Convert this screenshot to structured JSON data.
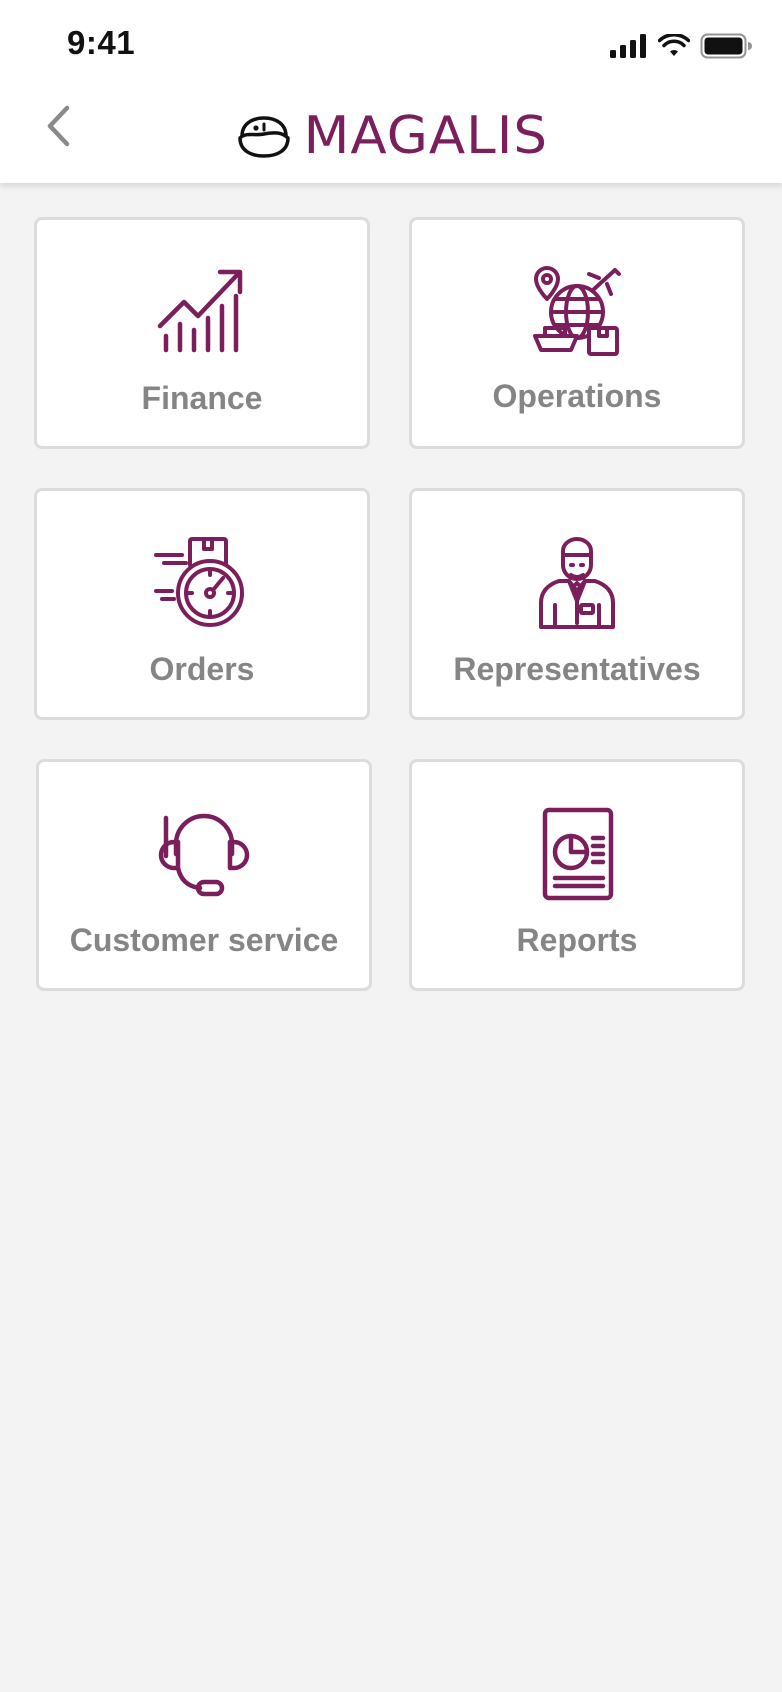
{
  "status_bar": {
    "time": "9:41",
    "icons": [
      "cellular-signal-icon",
      "wifi-icon",
      "battery-icon"
    ]
  },
  "header": {
    "back_icon": "chevron-left-icon",
    "logo_icon": "magalis-mascot-icon",
    "logo_text": "MAGALIS"
  },
  "theme": {
    "brand_color": "#7a1f5c",
    "label_color": "#858585",
    "tile_border": "#dcdcdc",
    "background": "#f3f3f3"
  },
  "tiles": [
    {
      "label": "Finance",
      "icon": "growth-chart-icon"
    },
    {
      "label": "Operations",
      "icon": "global-logistics-icon"
    },
    {
      "label": "Orders",
      "icon": "fast-delivery-stopwatch-icon"
    },
    {
      "label": "Representatives",
      "icon": "representative-person-icon"
    },
    {
      "label": "Customer service",
      "icon": "headset-icon"
    },
    {
      "label": "Reports",
      "icon": "report-document-icon"
    }
  ]
}
